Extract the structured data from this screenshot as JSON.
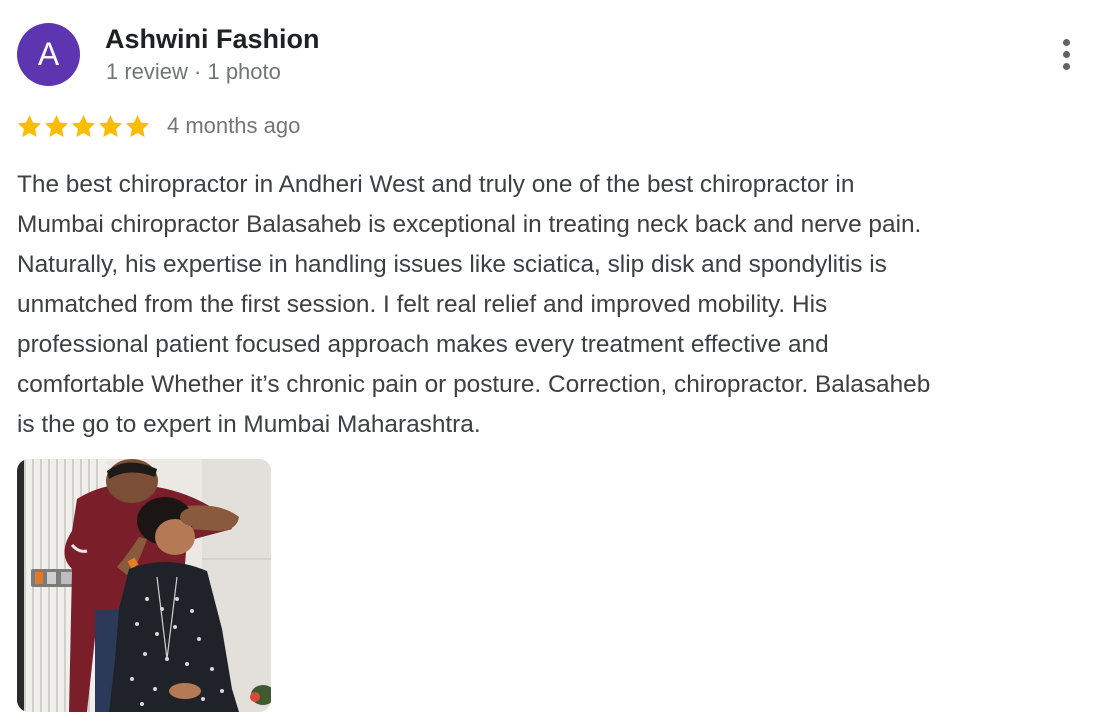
{
  "review": {
    "author": {
      "initial": "A",
      "name": "Ashwini Fashion",
      "meta": "1 review · 1 photo",
      "avatar_color": "#5e35b1"
    },
    "rating": {
      "stars": 5,
      "max": 5,
      "star_color": "#fbbc04"
    },
    "date": "4 months ago",
    "text": "The best chiropractor in Andheri West and truly one of the best chiropractor in\nMumbai chiropractor Balasaheb is exceptional in treating neck back and nerve pain.\nNaturally, his expertise in handling issues like sciatica, slip disk and spondylitis is\nunmatched from the first session. I felt real relief and improved mobility. His\nprofessional patient focused approach makes every treatment effective and\ncomfortable Whether it’s chronic pain or posture. Correction, chiropractor. Balasaheb\nis the go to expert in Mumbai Maharashtra.",
    "more_icon": "more-vertical-icon",
    "photo_count": 1
  }
}
